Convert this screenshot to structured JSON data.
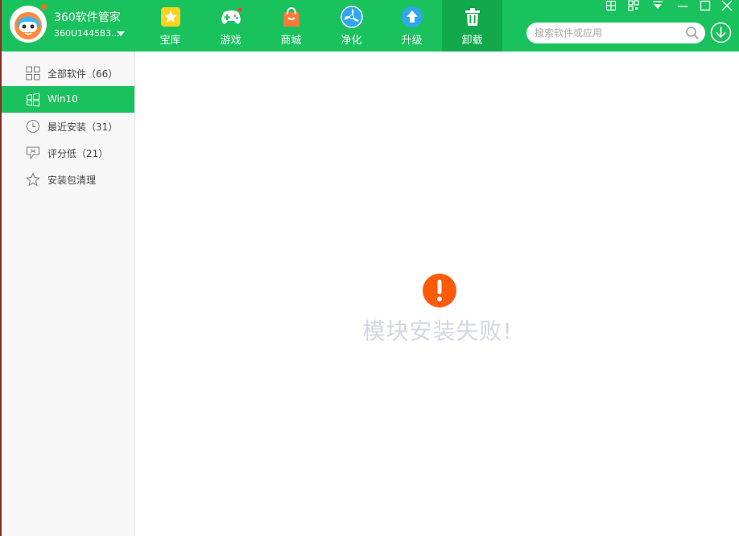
{
  "user": {
    "app_name": "360软件管家",
    "user_id": "360U144583..."
  },
  "nav": [
    {
      "label": "宝库",
      "icon": "star-icon"
    },
    {
      "label": "游戏",
      "icon": "gamepad-icon"
    },
    {
      "label": "商城",
      "icon": "shopping-bag-icon"
    },
    {
      "label": "净化",
      "icon": "fan-icon"
    },
    {
      "label": "升级",
      "icon": "upgrade-arrow-icon"
    },
    {
      "label": "卸载",
      "icon": "trash-icon"
    }
  ],
  "active_nav": "卸载",
  "window_controls": [
    "skin-icon",
    "qrcode-icon",
    "menu-caret-icon",
    "minimize-icon",
    "maximize-icon",
    "close-icon"
  ],
  "search": {
    "placeholder": "搜索软件或应用"
  },
  "sidebar": {
    "items": [
      {
        "label": "全部软件（66）",
        "icon": "grid-icon"
      },
      {
        "label": "Win10",
        "icon": "windows-icon"
      },
      {
        "label": "最近安装（31）",
        "icon": "clock-icon"
      },
      {
        "label": "评分低（21）",
        "icon": "thumbs-down-icon"
      },
      {
        "label": "安装包清理",
        "icon": "star-outline-icon"
      }
    ],
    "active_item": "Win10"
  },
  "main": {
    "error_message": "模块安装失败!"
  },
  "colors": {
    "brand_green": "#19c25d",
    "active_green": "#12a84c",
    "error_orange": "#ff5a0a",
    "error_text": "#d4d6e4"
  }
}
